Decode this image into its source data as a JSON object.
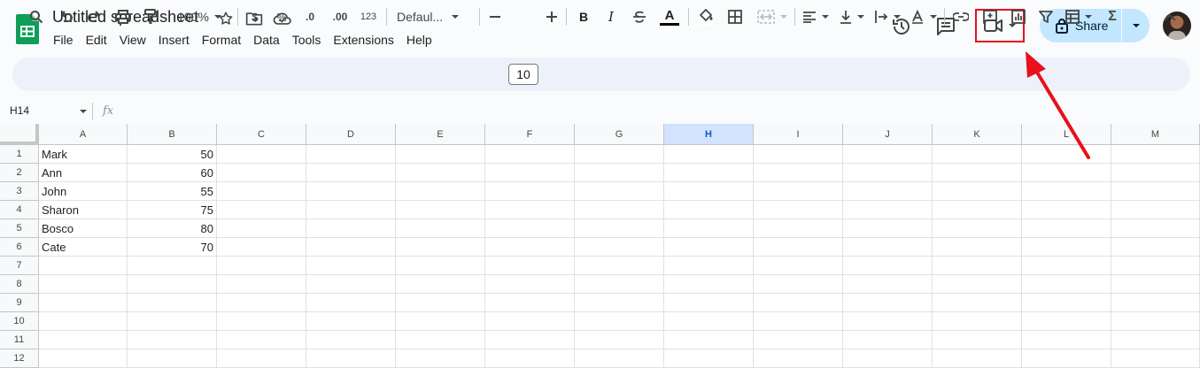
{
  "app": {
    "doc_title": "Untitled spreadsheet",
    "menus": [
      "File",
      "Edit",
      "View",
      "Insert",
      "Format",
      "Data",
      "Tools",
      "Extensions",
      "Help"
    ],
    "share_label": "Share",
    "accent": "#c2e7ff",
    "highlight_color": "#e8101b"
  },
  "toolbar": {
    "zoom": "100%",
    "currency": "$",
    "percent": "%",
    "dec_decrease": ".0",
    "dec_increase": ".00",
    "number_format": "123",
    "font": "Defaul...",
    "font_size": "10",
    "bold": "B",
    "italic": "I",
    "text_color": "A",
    "sum": "Σ"
  },
  "formula_bar": {
    "name_box": "H14",
    "fx": "fx",
    "value": ""
  },
  "sheet": {
    "columns": [
      "A",
      "B",
      "C",
      "D",
      "E",
      "F",
      "G",
      "H",
      "I",
      "J",
      "K",
      "L",
      "M"
    ],
    "selected_column": "H",
    "rows": [
      {
        "n": "1",
        "a": "Mark",
        "b": "50"
      },
      {
        "n": "2",
        "a": "Ann",
        "b": "60"
      },
      {
        "n": "3",
        "a": "John",
        "b": "55"
      },
      {
        "n": "4",
        "a": "Sharon",
        "b": "75"
      },
      {
        "n": "5",
        "a": "Bosco",
        "b": "80"
      },
      {
        "n": "6",
        "a": "Cate",
        "b": "70"
      },
      {
        "n": "7",
        "a": "",
        "b": ""
      },
      {
        "n": "8",
        "a": "",
        "b": ""
      },
      {
        "n": "9",
        "a": "",
        "b": ""
      },
      {
        "n": "10",
        "a": "",
        "b": ""
      },
      {
        "n": "11",
        "a": "",
        "b": ""
      },
      {
        "n": "12",
        "a": "",
        "b": ""
      }
    ]
  },
  "annotation": {
    "arrow_color": "#e8101b",
    "target": "meet-button"
  }
}
